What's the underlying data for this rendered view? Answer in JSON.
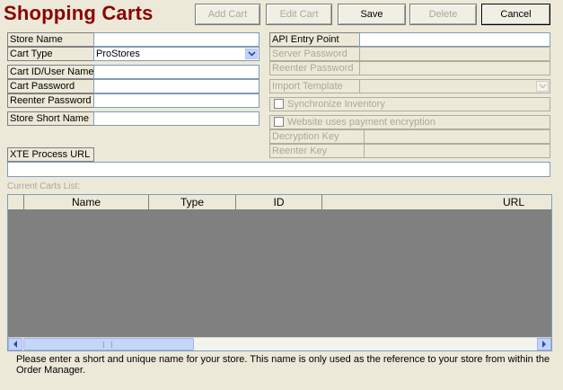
{
  "title": "Shopping Carts",
  "toolbar": {
    "add_cart": "Add Cart",
    "edit_cart": "Edit Cart",
    "save": "Save",
    "delete": "Delete",
    "cancel": "Cancel"
  },
  "left_form": {
    "store_name_label": "Store Name",
    "store_name_value": "",
    "cart_type_label": "Cart Type",
    "cart_type_value": "ProStores",
    "cart_id_label": "Cart ID/User Name",
    "cart_password_label": "Cart Password",
    "reenter_password_label": "Reenter Password",
    "store_short_name_label": "Store Short Name",
    "xte_process_url_label": "XTE Process URL"
  },
  "right_form": {
    "api_entry_point_label": "API Entry Point",
    "server_password_label": "Server Password",
    "reenter_password_label": "Reenter Password",
    "import_template_label": "Import Template",
    "synchronize_inventory_label": "Synchronize Inventory",
    "payment_encryption_label": "Website uses payment encryption",
    "decryption_key_label": "Decryption Key",
    "reenter_key_label": "Reenter Key"
  },
  "carts_list": {
    "label": "Current Carts List:",
    "columns": [
      "Name",
      "Type",
      "ID",
      "URL"
    ],
    "rows": []
  },
  "help_text": "Please enter a short and unique name for your store. This name is only used as the reference to your store from within the Order Manager.",
  "icons": {
    "dropdown": "chevron-down-icon",
    "scroll_left": "arrow-left-icon",
    "scroll_right": "arrow-right-icon",
    "scroll_grip": "grip-icon"
  },
  "colors": {
    "title": "#8b0000",
    "background": "#ece9d8",
    "grid_body": "#808080",
    "disabled_text": "#aca899"
  }
}
